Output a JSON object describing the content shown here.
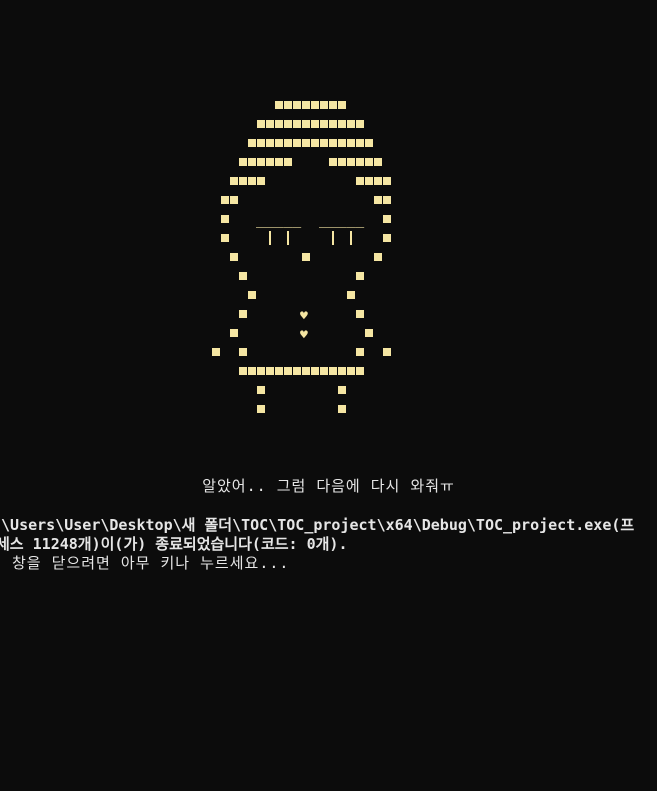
{
  "colors": {
    "background": "#0c0c0c",
    "art": "#f5e6a3",
    "text": "#e6e6e6"
  },
  "art": {
    "eye_bar": "_____",
    "heart_glyph": "♥"
  },
  "messages": {
    "goodbye": "알았어.. 그럼 다음에 다시 와줘ㅠ",
    "path": ":\\Users\\User\\Desktop\\새 폴더\\TOC\\TOC_project\\x64\\Debug\\TOC_project.exe(프",
    "exit": "세스 11248개)이(가) 종료되었습니다(코드: 0개).",
    "close_prompt": "창을 닫으려면 아무 키나 누르세요..."
  }
}
